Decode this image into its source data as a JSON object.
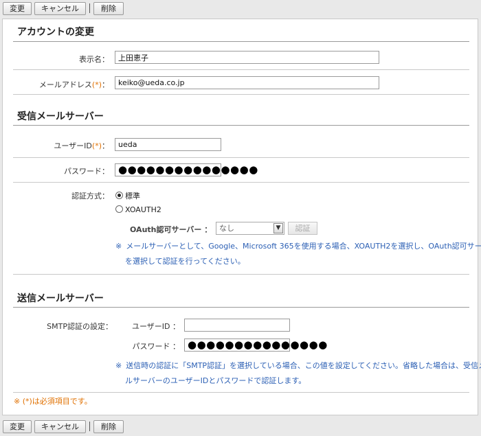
{
  "toolbar": {
    "change": "変更",
    "cancel": "キャンセル",
    "delete": "削除"
  },
  "account": {
    "title": "アカウントの変更",
    "display_name_label": "表示名：",
    "display_name_value": "上田恵子",
    "email_label": "メールアドレス",
    "email_value": "keiko@ueda.co.jp"
  },
  "required_mark": "(*)",
  "colon": "：",
  "incoming": {
    "title": "受信メールサーバー",
    "userid_label": "ユーザーID",
    "userid_value": "ueda",
    "password_label": "パスワード：",
    "password_value": "●●●●●●●●●●●●●●●",
    "auth_label": "認証方式：",
    "auth_options": [
      "標準",
      "XOAUTH2"
    ],
    "auth_selected": "標準",
    "oauth_server_label": "OAuth認可サーバー ：",
    "oauth_server_value": "なし",
    "auth_button": "認証",
    "note_mark": "※",
    "note_line1": "メールサーバーとして、Google、Microsoft 365を使用する場合、XOAUTH2を選択し、OAuth認可サーバー",
    "note_line2": "を選択して認証を行ってください。"
  },
  "outgoing": {
    "title": "送信メールサーバー",
    "smtp_label": "SMTP認証の設定：",
    "userid_label": "ユーザーID ：",
    "userid_value": "",
    "password_label": "パスワード ：",
    "password_value": "●●●●●●●●●●●●●●●",
    "note_mark": "※",
    "note_line1": "送信時の認証に「SMTP認証」を選択している場合、この値を設定してください。省略した場合は、受信メー",
    "note_line2": "ルサーバーのユーザーIDとパスワードで認証します。"
  },
  "footnote": "※ (*)は必須項目です。"
}
